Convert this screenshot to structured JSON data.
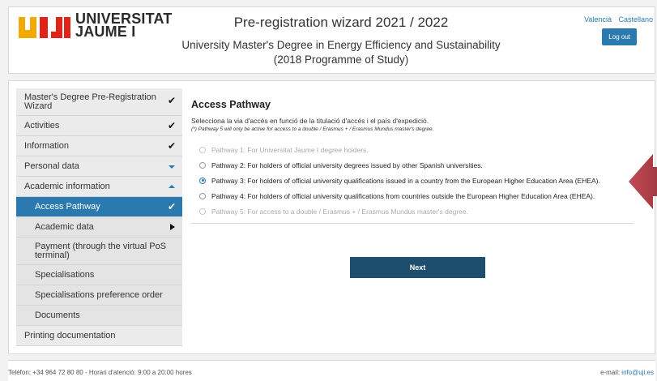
{
  "header": {
    "logo_line1": "UNIVERSITAT",
    "logo_line2": "JAUME I",
    "title": "Pre-registration wizard 2021 / 2022",
    "subtitle_line1": "University Master's Degree in Energy Efficiency and Sustainability",
    "subtitle_line2": "(2018 Programme of Study)",
    "lang_valencia": "Valencià",
    "lang_castellano": "Castellano",
    "logout_label": "Log out"
  },
  "sidebar": {
    "items": [
      {
        "label": "Master's Degree Pre-Registration Wizard",
        "status": "check"
      },
      {
        "label": "Activities",
        "status": "check"
      },
      {
        "label": "Information",
        "status": "check"
      },
      {
        "label": "Personal data",
        "status": "caret-down"
      },
      {
        "label": "Academic information",
        "status": "caret-up"
      },
      {
        "label": "Access Pathway",
        "status": "check"
      },
      {
        "label": "Academic data",
        "status": "triangle-right"
      },
      {
        "label": "Payment (through the virtual PoS terminal)"
      },
      {
        "label": "Specialisations"
      },
      {
        "label": "Specialisations preference order"
      },
      {
        "label": "Documents"
      },
      {
        "label": "Printing documentation"
      }
    ]
  },
  "main": {
    "section_title": "Access Pathway",
    "description": "Selecciona la via d'accés en funció de la titulació d'accés i el país d'expedició.",
    "note": "(*)  Pathway 5 will only be active for access to a double / Erasmus + / Erasmus Mundus master's degree.",
    "options": [
      {
        "label": "Pathway 1: For Universitat Jaume I degree holders.",
        "enabled": false,
        "selected": false
      },
      {
        "label": "Pathway 2: For holders of official university degrees issued by other Spanish universities.",
        "enabled": true,
        "selected": false
      },
      {
        "label": "Pathway 3: For holders of official university qualifications issued in a country from the European Higher Education Area (EHEA).",
        "enabled": true,
        "selected": true
      },
      {
        "label": "Pathway 4: For holders of official university qualifications from countries outside the European Higher Education Area (EHEA).",
        "enabled": true,
        "selected": false
      },
      {
        "label": "Pathway 5: For access to a double / Erasmus + / Erasmus Mundus master's degree.",
        "enabled": false,
        "selected": false
      }
    ],
    "next_label": "Next"
  },
  "footer": {
    "phone": "Telèfon: +34 964 72 80 80 - Horari d'atenció: 9:00 a 20:00 hores",
    "email_label": "e-mail: ",
    "email": "info@uji.es"
  },
  "colors": {
    "accent": "#2a7ab0",
    "next_button": "#1d4e6e",
    "arrow": "#b8454c",
    "logo_yellow": "#f2a900",
    "logo_red": "#e2231a"
  }
}
